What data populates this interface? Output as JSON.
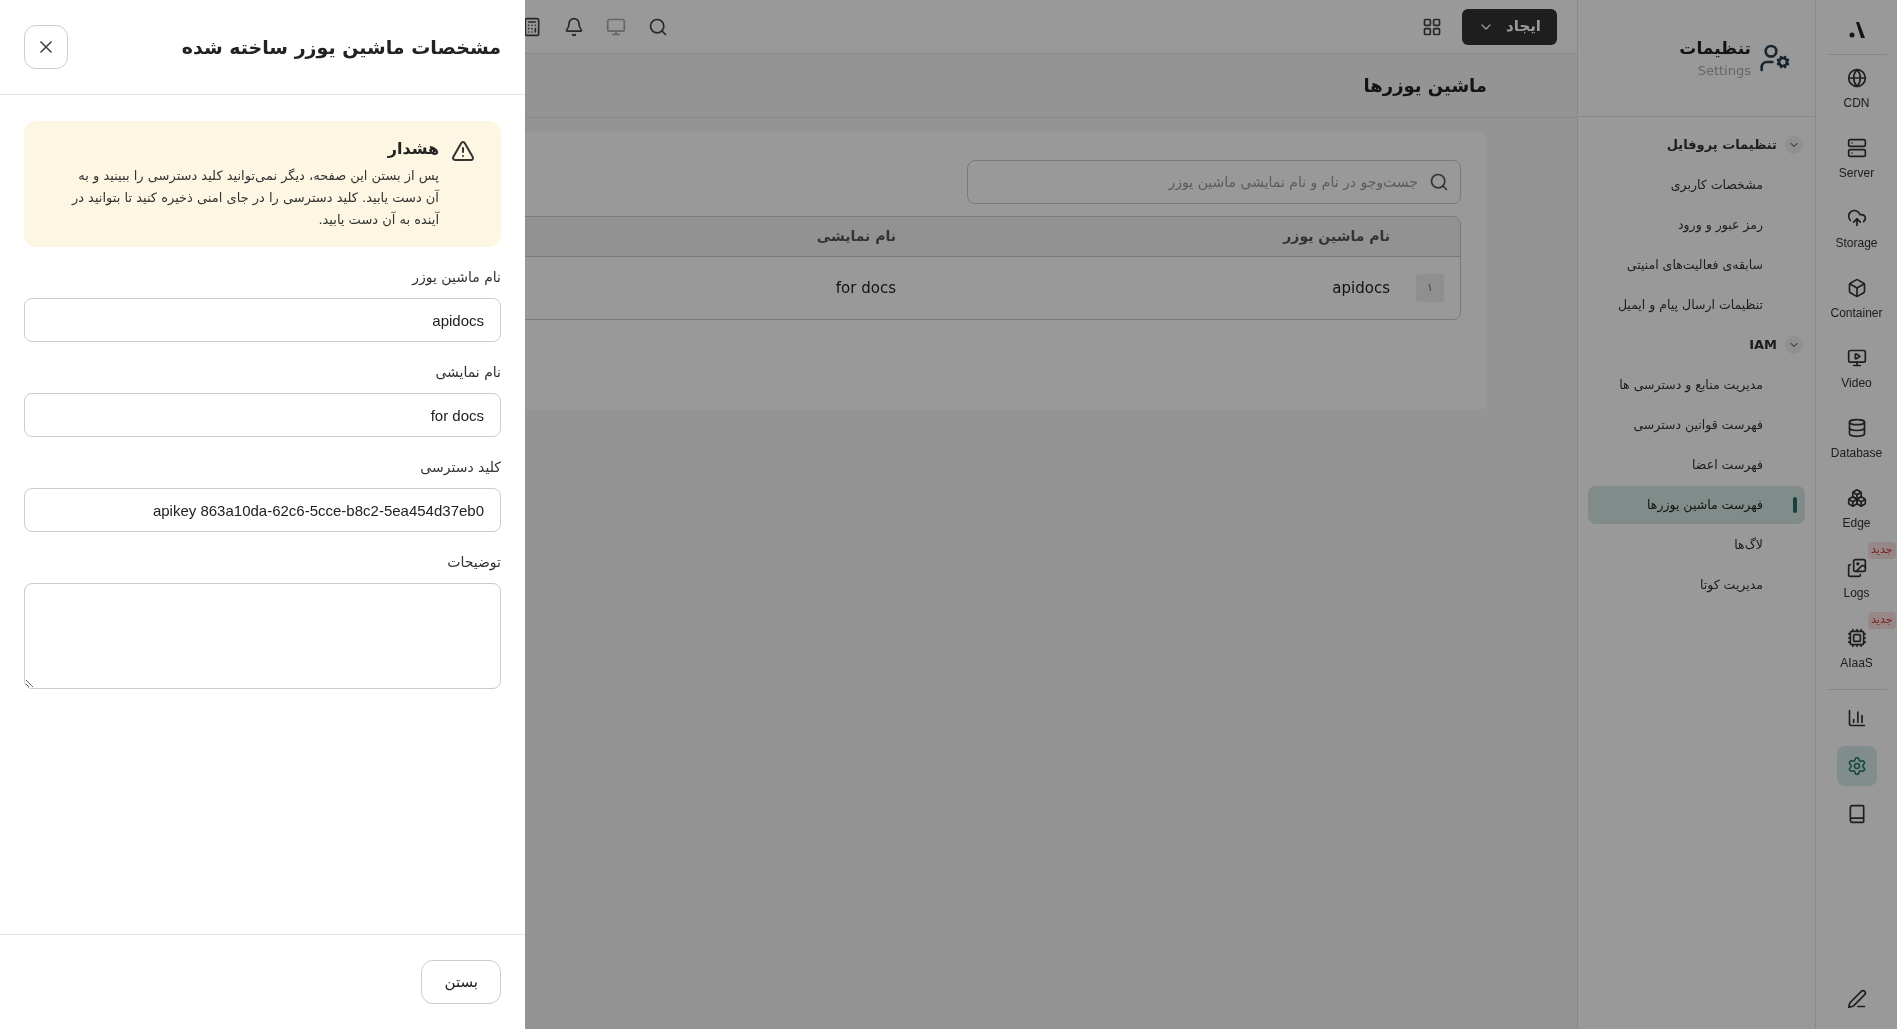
{
  "drawer": {
    "title": "مشخصات ماشین یوزر ساخته شده",
    "warning": {
      "title": "هشدار",
      "text": "پس از بستن این صفحه، دیگر نمی‌توانید کلید دسترسی را ببینید و به آن دست یابید. کلید دسترسی را در جای امنی ذخیره کنید تا بتوانید در آینده به آن دست یابید."
    },
    "fields": [
      {
        "kind": "input",
        "label": "نام ماشین یوزر",
        "value": "apidocs"
      },
      {
        "kind": "input",
        "label": "نام نمایشی",
        "value": "for docs"
      },
      {
        "kind": "input",
        "label": "کلید دسترسی",
        "value": "apikey 863a10da-62c6-5cce-b8c2-5ea454d37eb0"
      },
      {
        "kind": "textarea",
        "label": "توضیحات"
      }
    ],
    "close_button": "بستن"
  },
  "topbar": {
    "create_button": "ایجاد"
  },
  "page_title": "ماشین یوزرها",
  "search": {
    "placeholder": "جست‌وجو در نام و نام نمایشی ماشین یوزر"
  },
  "table": {
    "columns": [
      "نام ماشین یوزر",
      "نام نمایشی"
    ],
    "rows": [
      {
        "index": "۱",
        "cells": [
          "apidocs",
          "for docs"
        ]
      }
    ]
  },
  "sidebar": {
    "title": "تنظیمات",
    "subtitle": "Settings",
    "groups": [
      {
        "label": "تنظیمات پروفایل",
        "expanded": true,
        "items": [
          {
            "label": "مشخصات کاربری",
            "selected": false
          },
          {
            "label": "رمز عبور و ورود",
            "selected": false
          },
          {
            "label": "سابقه‌ی فعالیت‌های امنیتی",
            "selected": false
          },
          {
            "label": "تنظیمات ارسال پیام و ایمیل",
            "selected": false
          }
        ]
      },
      {
        "label": "IAM",
        "expanded": true,
        "items": [
          {
            "label": "مدیریت منابع و دسترسی ها",
            "selected": false
          },
          {
            "label": "فهرست قوانین دسترسی",
            "selected": false
          },
          {
            "label": "فهرست اعضا",
            "selected": false
          },
          {
            "label": "فهرست ماشین یوزرها",
            "selected": true
          },
          {
            "label": "لاگ‌ها",
            "selected": false
          },
          {
            "label": "مدیریت کوتا",
            "selected": false
          }
        ]
      }
    ]
  },
  "rail": {
    "products": [
      {
        "kind": "cdn",
        "label": "CDN"
      },
      {
        "kind": "server",
        "label": "Server"
      },
      {
        "kind": "storage",
        "label": "Storage"
      },
      {
        "kind": "container",
        "label": "Container"
      },
      {
        "kind": "video",
        "label": "Video"
      },
      {
        "kind": "database",
        "label": "Database"
      },
      {
        "kind": "edge",
        "label": "Edge"
      },
      {
        "kind": "logs",
        "label": "Logs",
        "badge": "جدید"
      },
      {
        "kind": "ai",
        "label": "AIaaS",
        "badge": "جدید"
      }
    ],
    "tools": [
      {
        "kind": "chart",
        "selected": false
      },
      {
        "kind": "settings",
        "selected": true
      },
      {
        "kind": "book",
        "selected": false
      }
    ]
  }
}
